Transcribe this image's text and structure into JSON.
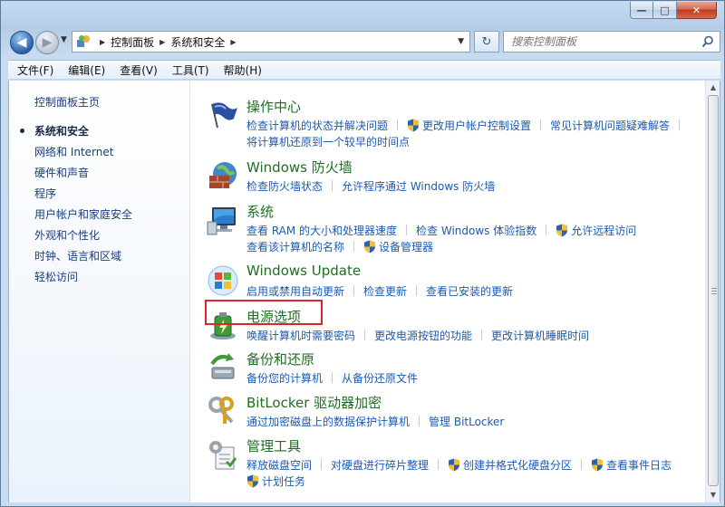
{
  "window": {
    "caption_min": "—",
    "caption_max": "□",
    "caption_close": "✕"
  },
  "nav": {
    "back": "◀",
    "forward": "▶",
    "breadcrumb": [
      "控制面板",
      "系统和安全"
    ],
    "refresh": "↻",
    "search_placeholder": "搜索控制面板"
  },
  "menubar": [
    "文件(F)",
    "编辑(E)",
    "查看(V)",
    "工具(T)",
    "帮助(H)"
  ],
  "sidebar": {
    "home": "控制面板主页",
    "items": [
      {
        "label": "系统和安全",
        "current": true
      },
      {
        "label": "网络和 Internet"
      },
      {
        "label": "硬件和声音"
      },
      {
        "label": "程序"
      },
      {
        "label": "用户帐户和家庭安全"
      },
      {
        "label": "外观和个性化"
      },
      {
        "label": "时钟、语言和区域"
      },
      {
        "label": "轻松访问"
      }
    ]
  },
  "categories": [
    {
      "title": "操作中心",
      "icon": "flag-icon",
      "rows": [
        [
          {
            "t": "检查计算机的状态并解决问题"
          },
          {
            "t": "更改用户帐户控制设置",
            "shield": true
          },
          {
            "t": "常见计算机问题疑难解答"
          }
        ],
        [
          {
            "t": "将计算机还原到一个较早的时间点"
          }
        ]
      ]
    },
    {
      "title": "Windows 防火墙",
      "icon": "firewall-icon",
      "rows": [
        [
          {
            "t": "检查防火墙状态"
          },
          {
            "t": "允许程序通过 Windows 防火墙"
          }
        ]
      ]
    },
    {
      "title": "系统",
      "icon": "computer-icon",
      "rows": [
        [
          {
            "t": "查看 RAM 的大小和处理器速度"
          },
          {
            "t": "检查 Windows 体验指数"
          },
          {
            "t": "允许远程访问",
            "shield": true
          }
        ],
        [
          {
            "t": "查看该计算机的名称"
          },
          {
            "t": "设备管理器",
            "shield": true
          }
        ]
      ]
    },
    {
      "title": "Windows Update",
      "icon": "windows-update-icon",
      "rows": [
        [
          {
            "t": "启用或禁用自动更新"
          },
          {
            "t": "检查更新"
          },
          {
            "t": "查看已安装的更新"
          }
        ]
      ]
    },
    {
      "title": "电源选项",
      "icon": "battery-icon",
      "rows": [
        [
          {
            "t": "唤醒计算机时需要密码"
          },
          {
            "t": "更改电源按钮的功能"
          },
          {
            "t": "更改计算机睡眠时间"
          }
        ]
      ]
    },
    {
      "title": "备份和还原",
      "icon": "backup-icon",
      "rows": [
        [
          {
            "t": "备份您的计算机"
          },
          {
            "t": "从备份还原文件"
          }
        ]
      ]
    },
    {
      "title": "BitLocker 驱动器加密",
      "icon": "keys-icon",
      "rows": [
        [
          {
            "t": "通过加密磁盘上的数据保护计算机"
          },
          {
            "t": "管理 BitLocker"
          }
        ]
      ]
    },
    {
      "title": "管理工具",
      "icon": "admin-tools-icon",
      "rows": [
        [
          {
            "t": "释放磁盘空间"
          },
          {
            "t": "对硬盘进行碎片整理"
          },
          {
            "t": "创建并格式化硬盘分区",
            "shield": true
          },
          {
            "t": "查看事件日志",
            "shield": true
          }
        ],
        [
          {
            "t": "计划任务",
            "shield": true
          }
        ]
      ]
    }
  ],
  "colors": {
    "link": "#1c5ab0",
    "category_title": "#1e6f22",
    "highlight_box": "#d9262b"
  }
}
